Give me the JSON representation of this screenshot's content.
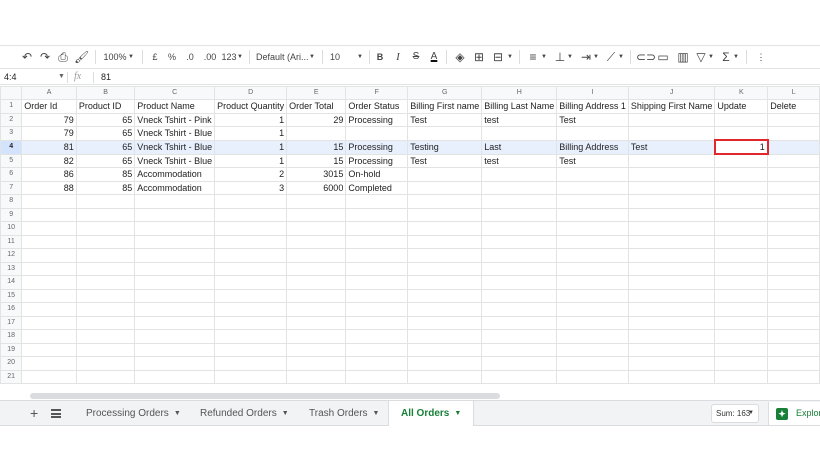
{
  "toolbar": {
    "zoom": "100%",
    "currency": "£",
    "percent": "%",
    "dec_less": ".0",
    "dec_more": ".00",
    "more_formats": "123",
    "font": "Default (Ari...",
    "font_size": "10",
    "bold": "B",
    "italic": "I",
    "strike": "S",
    "text_color": "A"
  },
  "formula_bar": {
    "name_box": "4:4",
    "fx": "fx",
    "value": "81"
  },
  "grid": {
    "columns": [
      "A",
      "B",
      "C",
      "D",
      "E",
      "F",
      "G",
      "H",
      "I",
      "J",
      "K",
      "L"
    ],
    "rows": [
      {
        "n": "1",
        "cells": [
          "Order Id",
          "Product ID",
          "Product Name",
          "Product Quantity",
          "Order Total",
          "Order Status",
          "Billing First name",
          "Billing Last Name",
          "Billing Address 1",
          "Shipping First Name",
          "Update",
          "Delete"
        ]
      },
      {
        "n": "2",
        "cells": [
          "79",
          "65",
          "Vneck Tshirt - Pink",
          "1",
          "29",
          "Processing",
          "Test",
          "test",
          "Test",
          "",
          "",
          ""
        ]
      },
      {
        "n": "3",
        "cells": [
          "79",
          "65",
          "Vneck Tshirt - Blue",
          "1",
          "",
          "",
          "",
          "",
          "",
          "",
          "",
          ""
        ]
      },
      {
        "n": "4",
        "cells": [
          "81",
          "65",
          "Vneck Tshirt - Blue",
          "1",
          "15",
          "Processing",
          "Testing",
          "Last",
          "Billing Address",
          "Test",
          "1",
          ""
        ]
      },
      {
        "n": "5",
        "cells": [
          "82",
          "65",
          "Vneck Tshirt - Blue",
          "1",
          "15",
          "Processing",
          "Test",
          "test",
          "Test",
          "",
          "",
          ""
        ]
      },
      {
        "n": "6",
        "cells": [
          "86",
          "85",
          "Accommodation",
          "2",
          "3015",
          "On-hold",
          "",
          "",
          "",
          "",
          "",
          ""
        ]
      },
      {
        "n": "7",
        "cells": [
          "88",
          "85",
          "Accommodation",
          "3",
          "6000",
          "Completed",
          "",
          "",
          "",
          "",
          "",
          ""
        ]
      },
      {
        "n": "8",
        "cells": [
          "",
          "",
          "",
          "",
          "",
          "",
          "",
          "",
          "",
          "",
          "",
          ""
        ]
      },
      {
        "n": "9",
        "cells": [
          "",
          "",
          "",
          "",
          "",
          "",
          "",
          "",
          "",
          "",
          "",
          ""
        ]
      },
      {
        "n": "10",
        "cells": [
          "",
          "",
          "",
          "",
          "",
          "",
          "",
          "",
          "",
          "",
          "",
          ""
        ]
      },
      {
        "n": "11",
        "cells": [
          "",
          "",
          "",
          "",
          "",
          "",
          "",
          "",
          "",
          "",
          "",
          ""
        ]
      },
      {
        "n": "12",
        "cells": [
          "",
          "",
          "",
          "",
          "",
          "",
          "",
          "",
          "",
          "",
          "",
          ""
        ]
      },
      {
        "n": "13",
        "cells": [
          "",
          "",
          "",
          "",
          "",
          "",
          "",
          "",
          "",
          "",
          "",
          ""
        ]
      },
      {
        "n": "14",
        "cells": [
          "",
          "",
          "",
          "",
          "",
          "",
          "",
          "",
          "",
          "",
          "",
          ""
        ]
      },
      {
        "n": "15",
        "cells": [
          "",
          "",
          "",
          "",
          "",
          "",
          "",
          "",
          "",
          "",
          "",
          ""
        ]
      },
      {
        "n": "16",
        "cells": [
          "",
          "",
          "",
          "",
          "",
          "",
          "",
          "",
          "",
          "",
          "",
          ""
        ]
      },
      {
        "n": "17",
        "cells": [
          "",
          "",
          "",
          "",
          "",
          "",
          "",
          "",
          "",
          "",
          "",
          ""
        ]
      },
      {
        "n": "18",
        "cells": [
          "",
          "",
          "",
          "",
          "",
          "",
          "",
          "",
          "",
          "",
          "",
          ""
        ]
      },
      {
        "n": "19",
        "cells": [
          "",
          "",
          "",
          "",
          "",
          "",
          "",
          "",
          "",
          "",
          "",
          ""
        ]
      },
      {
        "n": "20",
        "cells": [
          "",
          "",
          "",
          "",
          "",
          "",
          "",
          "",
          "",
          "",
          "",
          ""
        ]
      },
      {
        "n": "21",
        "cells": [
          "",
          "",
          "",
          "",
          "",
          "",
          "",
          "",
          "",
          "",
          "",
          ""
        ]
      }
    ],
    "numeric_columns": [
      0,
      1,
      3,
      4,
      10
    ],
    "selected_row": "4",
    "active_cell": "K4"
  },
  "sheets": {
    "tabs": [
      {
        "label": "Processing Orders",
        "active": false
      },
      {
        "label": "Refunded Orders",
        "active": false
      },
      {
        "label": "Trash Orders",
        "active": false
      },
      {
        "label": "All Orders",
        "active": true
      }
    ],
    "sum": "Sum: 163",
    "explore": "Explore"
  },
  "colors": {
    "accent_green": "#188038",
    "active_cell_border": "#e3262b",
    "selection_fill": "#e8f0fe"
  }
}
